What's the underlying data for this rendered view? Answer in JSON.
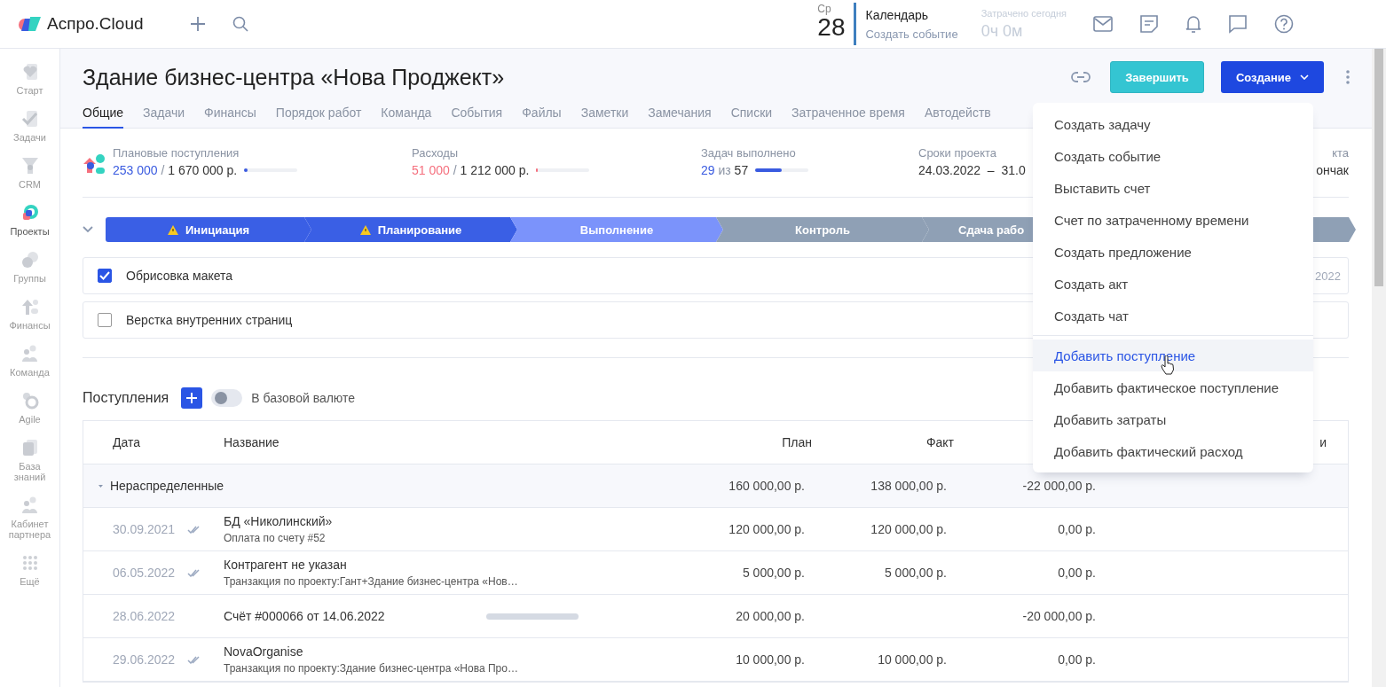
{
  "app": {
    "brand": "Аспро.Cloud"
  },
  "calendar": {
    "weekday": "Ср",
    "day": "28",
    "title": "Календарь",
    "action": "Создать событие"
  },
  "time_spent": {
    "label": "Затрачено сегодня",
    "value": "0ч 0м"
  },
  "sidebar": {
    "items": [
      {
        "label": "Старт",
        "selected": false
      },
      {
        "label": "Задачи",
        "selected": false
      },
      {
        "label": "CRM",
        "selected": false
      },
      {
        "label": "Проекты",
        "selected": true
      },
      {
        "label": "Группы",
        "selected": false
      },
      {
        "label": "Финансы",
        "selected": false
      },
      {
        "label": "Команда",
        "selected": false
      },
      {
        "label": "Agile",
        "selected": false
      },
      {
        "label": "База знаний",
        "selected": false
      },
      {
        "label": "Кабинет партнера",
        "selected": false
      },
      {
        "label": "Ещё",
        "selected": false
      }
    ]
  },
  "project": {
    "title": "Здание бизнес-центра «Нова Проджект»",
    "finish_button": "Завершить",
    "create_button": "Создание"
  },
  "tabs": [
    {
      "label": "Общие",
      "selected": true
    },
    {
      "label": "Задачи",
      "selected": false
    },
    {
      "label": "Финансы",
      "selected": false
    },
    {
      "label": "Порядок работ",
      "selected": false
    },
    {
      "label": "Команда",
      "selected": false
    },
    {
      "label": "События",
      "selected": false
    },
    {
      "label": "Файлы",
      "selected": false
    },
    {
      "label": "Заметки",
      "selected": false
    },
    {
      "label": "Замечания",
      "selected": false
    },
    {
      "label": "Списки",
      "selected": false
    },
    {
      "label": "Затраченное время",
      "selected": false
    },
    {
      "label": "Автодейств",
      "selected": false
    }
  ],
  "stats": [
    {
      "kind": "progress",
      "label": "Плановые поступления",
      "done": "253 000",
      "separator": "/",
      "total": "1 670 000 р.",
      "level": 0.07,
      "color": "#3a5be0"
    },
    {
      "kind": "progress",
      "label": "Расходы",
      "done": "51 000",
      "separator": "/",
      "total": "1 212 000 р.",
      "level": 0.03,
      "color": "#f5707e"
    },
    {
      "kind": "count",
      "label": "Задач выполнено",
      "done": "29",
      "separator": "из",
      "total": "57",
      "level": 0.5,
      "color": "#3a5be0"
    },
    {
      "kind": "dates",
      "label": "Сроки проекта",
      "start": "24.03.2022",
      "separator": "–",
      "end": "31.0"
    },
    {
      "kind": "text",
      "label": "кта",
      "value": "ончак"
    }
  ],
  "stages": [
    {
      "name": "Инициация",
      "completed": true,
      "selected": false,
      "warning": true
    },
    {
      "name": "Планирование",
      "completed": true,
      "selected": false,
      "warning": true
    },
    {
      "name": "Выполнение",
      "completed": false,
      "selected": true,
      "warning": false
    },
    {
      "name": "Контроль",
      "completed": false,
      "selected": false,
      "warning": false
    },
    {
      "name": "Сдача рабо",
      "completed": false,
      "selected": false,
      "warning": false
    }
  ],
  "checklist": [
    {
      "text": "Обрисовка макета",
      "checked": true,
      "date": "2022"
    },
    {
      "text": "Верстка внутренних страниц",
      "checked": false
    }
  ],
  "income": {
    "title": "Поступления",
    "toggle": {
      "label": "В базовой валюте",
      "on": false
    },
    "columns": [
      "Дата",
      "Название",
      "План",
      "Факт",
      "",
      "и"
    ],
    "group": {
      "name": "Нераспределенные",
      "expanded": true,
      "plan": "160 000,00 р.",
      "fact": "138 000,00 р.",
      "diff": "-22 000,00 р."
    },
    "rows": [
      {
        "date": "30.09.2021",
        "confirmed": true,
        "title": "БД «Николинский»",
        "subtitle": "Оплата по счету #52",
        "pending": false,
        "plan": "120 000,00 р.",
        "fact": "120 000,00 р.",
        "diff": "0,00 р."
      },
      {
        "date": "06.05.2022",
        "confirmed": true,
        "title": "Контрагент не указан",
        "subtitle": "Транзакция по проекту:Гант+Здание бизнес-центра «Нов…",
        "pending": false,
        "plan": "5 000,00 р.",
        "fact": "5 000,00 р.",
        "diff": "0,00 р."
      },
      {
        "date": "28.06.2022",
        "confirmed": false,
        "title": "Счёт #000066 от 14.06.2022",
        "pending": true,
        "plan": "20 000,00 р.",
        "diff": "-20 000,00 р."
      },
      {
        "date": "29.06.2022",
        "confirmed": true,
        "title": "NovaOrganise",
        "subtitle": "Транзакция по проекту:Здание бизнес-центра «Нова Про…",
        "pending": false,
        "plan": "10 000,00 р.",
        "fact": "10 000,00 р.",
        "diff": "0,00 р."
      }
    ]
  },
  "create_menu": {
    "groups": [
      [
        {
          "label": "Создать задачу",
          "selected": false
        },
        {
          "label": "Создать событие",
          "selected": false
        },
        {
          "label": "Выставить счет",
          "selected": false
        },
        {
          "label": "Счет по затраченному времени",
          "selected": false
        },
        {
          "label": "Создать предложение",
          "selected": false
        },
        {
          "label": "Создать акт",
          "selected": false
        },
        {
          "label": "Создать чат",
          "selected": false
        }
      ],
      [
        {
          "label": "Добавить поступление",
          "selected": true
        },
        {
          "label": "Добавить фактическое поступление",
          "selected": false
        },
        {
          "label": "Добавить затраты",
          "selected": false
        },
        {
          "label": "Добавить фактический расход",
          "selected": false
        }
      ]
    ]
  }
}
